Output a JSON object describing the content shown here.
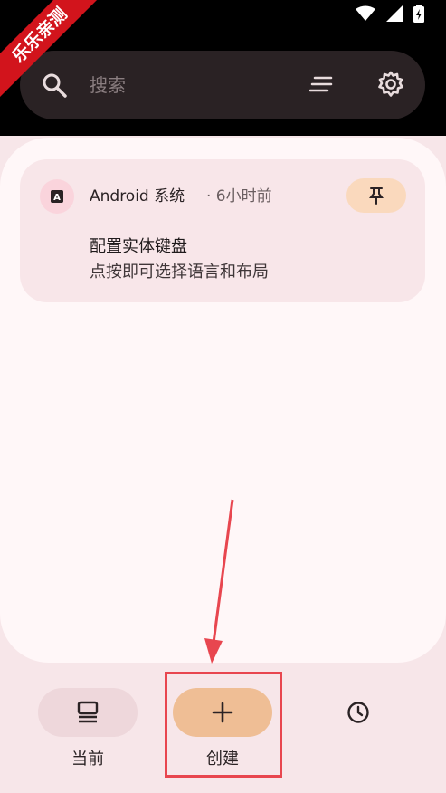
{
  "watermark": "乐乐亲测",
  "search": {
    "placeholder": "搜索"
  },
  "notification": {
    "app_name": "Android 系统",
    "time": "· 6小时前",
    "title": "配置实体键盘",
    "body": "点按即可选择语言和布局",
    "app_glyph": "A"
  },
  "bottom_nav": {
    "items": [
      {
        "label": "当前",
        "icon": "stack-icon"
      },
      {
        "label": "创建",
        "icon": "plus-icon"
      },
      {
        "label": "",
        "icon": "clock-icon"
      }
    ]
  },
  "colors": {
    "accent_create": "#efbe95",
    "pin_bg": "#fad9bd",
    "highlight": "#e8464f"
  }
}
